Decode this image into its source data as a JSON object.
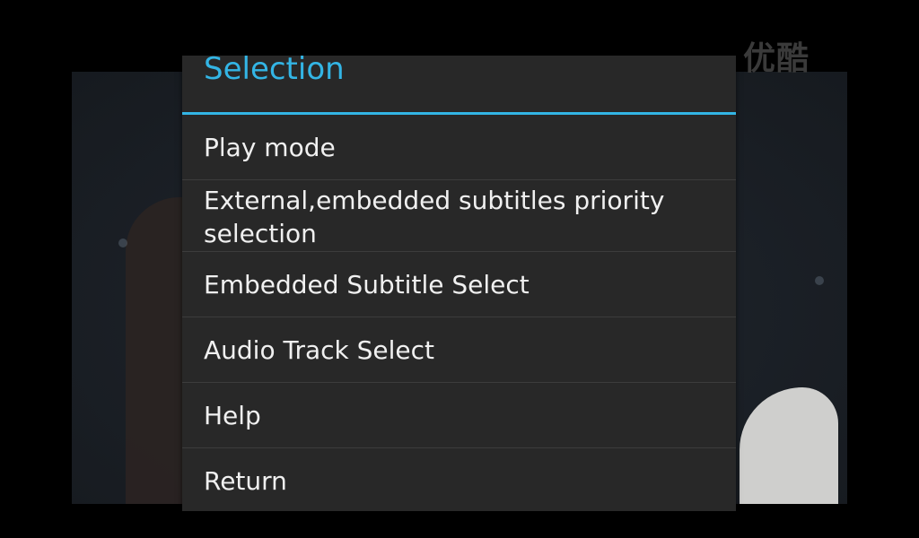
{
  "background": {
    "watermark_text": "优酷",
    "colors": {
      "backdrop": "#000000",
      "video_tint": "#1c2128"
    }
  },
  "dialog": {
    "title": "Selection",
    "accent_color": "#33b5e5",
    "background_color": "#282828",
    "items": [
      {
        "label": "Play mode"
      },
      {
        "label": "External,embedded subtitles priority selection"
      },
      {
        "label": "Embedded Subtitle Select"
      },
      {
        "label": "Audio Track Select"
      },
      {
        "label": "Help"
      },
      {
        "label": "Return"
      }
    ]
  }
}
